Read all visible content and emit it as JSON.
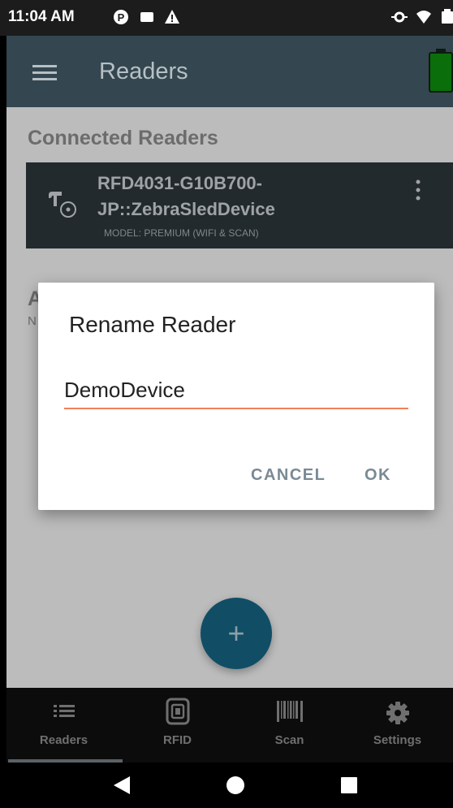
{
  "status_bar": {
    "time": "11:04 AM",
    "icons": [
      "notification-p-icon",
      "notification-square-icon",
      "warning-icon",
      "sync-icon",
      "wifi-icon",
      "battery-status-icon"
    ]
  },
  "app_bar": {
    "title": "Readers",
    "menu_icon": "hamburger-menu-icon",
    "battery_icon": "reader-battery-icon",
    "battery_color": "#0a6e0a"
  },
  "connected_section": {
    "label": "Connected Readers",
    "reader": {
      "name": "RFD4031-G10B700-JP::ZebraSledDevice",
      "model": "MODEL: PREMIUM (WIFI & SCAN)",
      "icon": "rfid-reader-icon",
      "menu_icon": "more-vertical-icon"
    }
  },
  "available_section": {
    "label": "A",
    "sublabel": "N"
  },
  "dialog": {
    "title": "Rename Reader",
    "input_value": "DemoDevice",
    "cancel_label": "CANCEL",
    "ok_label": "OK",
    "accent_color": "#f0805c"
  },
  "fab": {
    "label": "+",
    "color": "#114e66"
  },
  "bottom_nav": {
    "items": [
      {
        "label": "Readers",
        "icon": "list-icon",
        "active": true
      },
      {
        "label": "RFID",
        "icon": "rfid-tag-icon",
        "active": false
      },
      {
        "label": "Scan",
        "icon": "barcode-icon",
        "active": false
      },
      {
        "label": "Settings",
        "icon": "gear-icon",
        "active": false
      }
    ]
  },
  "system_nav": {
    "icons": [
      "back-icon",
      "home-icon",
      "recents-icon"
    ]
  }
}
